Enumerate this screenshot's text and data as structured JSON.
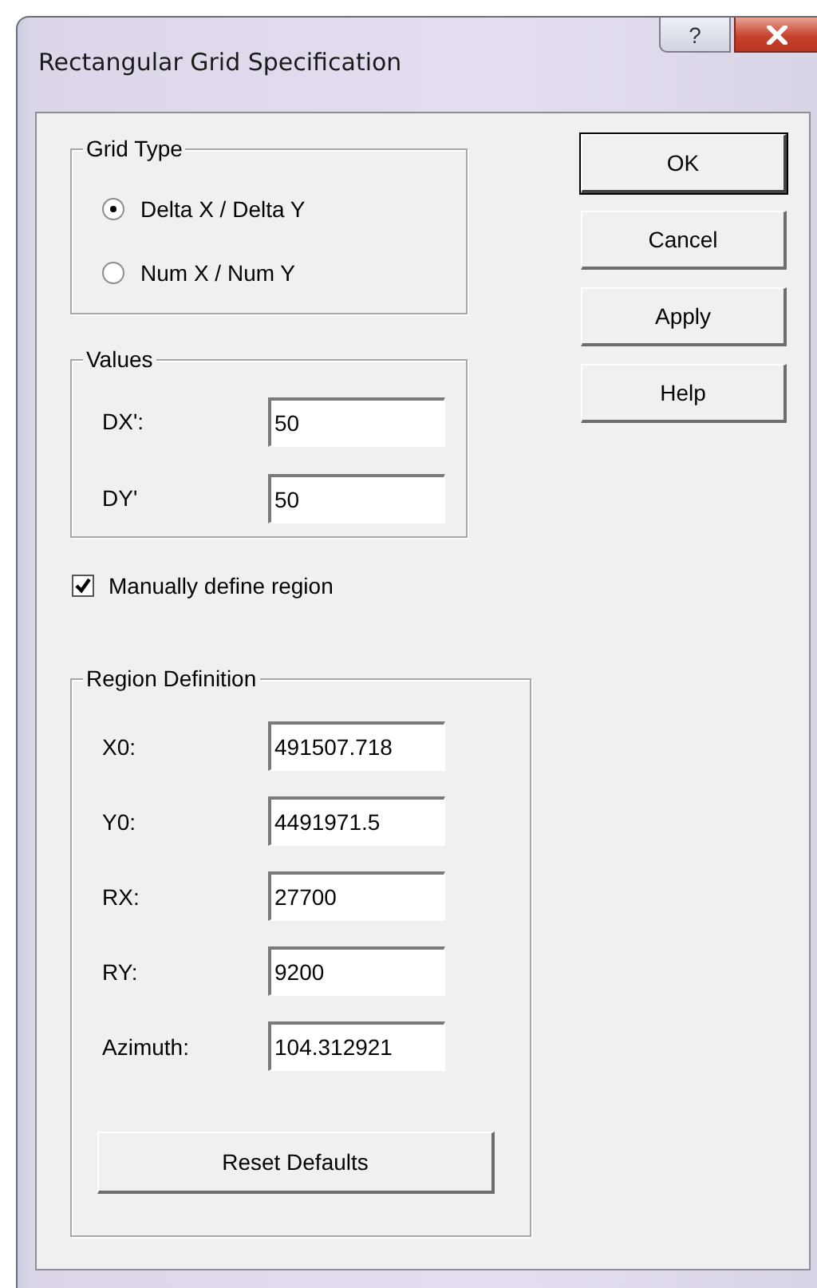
{
  "window": {
    "title": "Rectangular Grid Specification",
    "help_button": "?"
  },
  "grid_type": {
    "title": "Grid Type",
    "options": [
      {
        "label": "Delta X / Delta Y",
        "selected": true
      },
      {
        "label": "Num X / Num Y",
        "selected": false
      }
    ]
  },
  "values": {
    "title": "Values",
    "fields": [
      {
        "label": "DX':",
        "value": "50"
      },
      {
        "label": "DY'",
        "value": "50"
      }
    ]
  },
  "manual_region": {
    "label": "Manually define region",
    "checked": true
  },
  "region_definition": {
    "title": "Region Definition",
    "fields": [
      {
        "label": "X0:",
        "value": "491507.718"
      },
      {
        "label": "Y0:",
        "value": "4491971.5"
      },
      {
        "label": "RX:",
        "value": "27700"
      },
      {
        "label": "RY:",
        "value": "9200"
      },
      {
        "label": "Azimuth:",
        "value": "104.312921"
      }
    ],
    "reset_button": "Reset Defaults"
  },
  "buttons": [
    {
      "label": "OK",
      "default": true
    },
    {
      "label": "Cancel",
      "default": false
    },
    {
      "label": "Apply",
      "default": false
    },
    {
      "label": "Help",
      "default": false
    }
  ]
}
